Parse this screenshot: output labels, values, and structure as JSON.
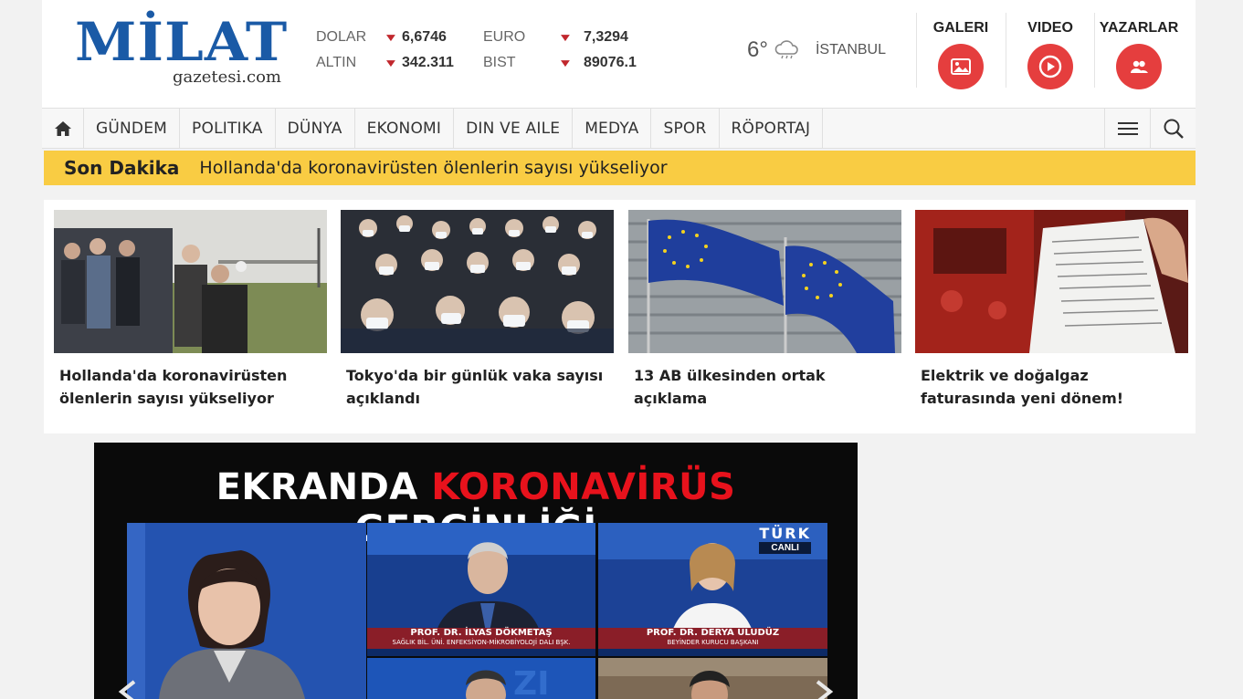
{
  "logo": {
    "name": "MİLAT",
    "sub": "gazetesi.com"
  },
  "markets": [
    {
      "name": "DOLAR",
      "value": "6,6746"
    },
    {
      "name": "EURO",
      "value": "7,3294"
    },
    {
      "name": "ALTIN",
      "value": "342.311"
    },
    {
      "name": "BIST",
      "value": "89076.1"
    }
  ],
  "weather": {
    "temp": "6°",
    "city": "İSTANBUL",
    "icon": "rain-cloud-icon"
  },
  "quick_links": [
    {
      "label": "GALERI",
      "icon": "image-icon"
    },
    {
      "label": "VIDEO",
      "icon": "play-icon"
    },
    {
      "label": "YAZARLAR",
      "icon": "users-icon"
    }
  ],
  "nav": {
    "items": [
      "GÜNDEM",
      "POLITIKA",
      "DÜNYA",
      "EKONOMI",
      "DIN VE AILE",
      "MEDYA",
      "SPOR",
      "RÖPORTAJ"
    ]
  },
  "breaking": {
    "label": "Son Dakika",
    "text": "Hollanda'da koronavirüsten ölenlerin sayısı yükseliyor"
  },
  "cards": [
    {
      "title": "Hollanda'da koronavirüsten ölenlerin sayısı yükseliyor"
    },
    {
      "title": "Tokyo'da bir günlük vaka sayısı açıklandı"
    },
    {
      "title": "13 AB ülkesinden ortak açıklama"
    },
    {
      "title": "Elektrik ve doğalgaz faturasında yeni dönem!"
    }
  ],
  "video": {
    "title_part1": "EKRANDA ",
    "title_part2": "KORONAVİRÜS",
    "title_part3": " GERGİNLİĞİ",
    "channel": "TÜRK",
    "live": "CANLI",
    "guest1_name": "PROF. DR. İLYAS DÖKMETAŞ",
    "guest1_role": "SAĞLIK BİL. ÜNİ. ENFEKSİYON-MİKROBİYOLOJİ DALI BŞK.",
    "guest2_name": "PROF. DR. DERYA ULUDÜZ",
    "guest2_role": "BEYİNDER KURUCU BAŞKANI"
  }
}
